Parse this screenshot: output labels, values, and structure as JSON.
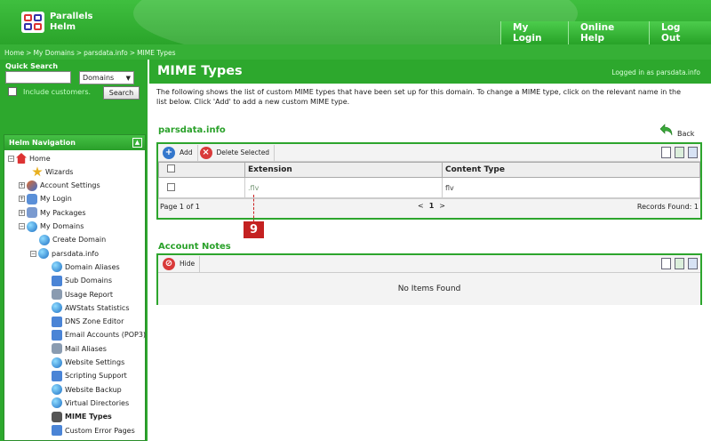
{
  "header": {
    "logo_line1": "Parallels",
    "logo_line2": "Helm",
    "nav": [
      "My Login",
      "Online Help",
      "Log Out"
    ]
  },
  "breadcrumb": [
    "Home",
    "My Domains",
    "parsdata.info",
    "MIME Types"
  ],
  "quick_search": {
    "title": "Quick Search",
    "input_value": "",
    "select_value": "Domains",
    "include_label": "Include customers.",
    "button": "Search"
  },
  "nav_panel": {
    "title": "Helm Navigation",
    "collapse": "▲",
    "items": [
      {
        "label": "Home",
        "icon": "home-icon"
      },
      {
        "label": "Wizards",
        "icon": "wizard-icon"
      },
      {
        "label": "Account Settings",
        "icon": "account-settings-icon"
      },
      {
        "label": "My Login",
        "icon": "login-icon"
      },
      {
        "label": "My Packages",
        "icon": "packages-icon"
      },
      {
        "label": "My Domains",
        "icon": "globe-icon"
      },
      {
        "label": "Create Domain",
        "icon": "globe-icon"
      },
      {
        "label": "parsdata.info",
        "icon": "globe-icon"
      },
      {
        "label": "Domain Aliases",
        "icon": "globe-icon"
      },
      {
        "label": "Sub Domains",
        "icon": "globe-icon"
      },
      {
        "label": "Usage Report",
        "icon": "report-icon"
      },
      {
        "label": "AWStats Statistics",
        "icon": "stats-icon"
      },
      {
        "label": "DNS Zone Editor",
        "icon": "dns-icon"
      },
      {
        "label": "Email Accounts (POP3)",
        "icon": "email-icon"
      },
      {
        "label": "Mail Aliases",
        "icon": "mail-alias-icon"
      },
      {
        "label": "Website Settings",
        "icon": "website-icon"
      },
      {
        "label": "Scripting Support",
        "icon": "script-icon"
      },
      {
        "label": "Website Backup",
        "icon": "backup-icon"
      },
      {
        "label": "Virtual Directories",
        "icon": "folder-icon"
      },
      {
        "label": "MIME Types",
        "icon": "mime-icon"
      },
      {
        "label": "Custom Error Pages",
        "icon": "error-page-icon"
      }
    ]
  },
  "main": {
    "title": "MIME Types",
    "logged_in": "Logged in as parsdata.info",
    "description": "The following shows the list of custom MIME types that have been set up for this domain. To change a MIME type, click on the relevant name in the list below. Click 'Add' to add a new custom MIME type.",
    "domain_label": "parsdata.info",
    "back_label": "Back",
    "toolbar": {
      "add": "Add",
      "delete": "Delete Selected"
    },
    "columns": [
      "Extension",
      "Content Type"
    ],
    "rows": [
      {
        "extension": ".flv",
        "content_type": "flv"
      }
    ],
    "pager": {
      "page_info": "Page 1 of 1",
      "prev": "<",
      "current": "1",
      "next": ">",
      "records": "Records Found: 1"
    },
    "callout_number": "9",
    "notes": {
      "label": "Account Notes",
      "hide": "Hide",
      "empty": "No Items Found"
    }
  },
  "colors": {
    "brand_green": "#2da82d",
    "callout_red": "#c42121"
  }
}
